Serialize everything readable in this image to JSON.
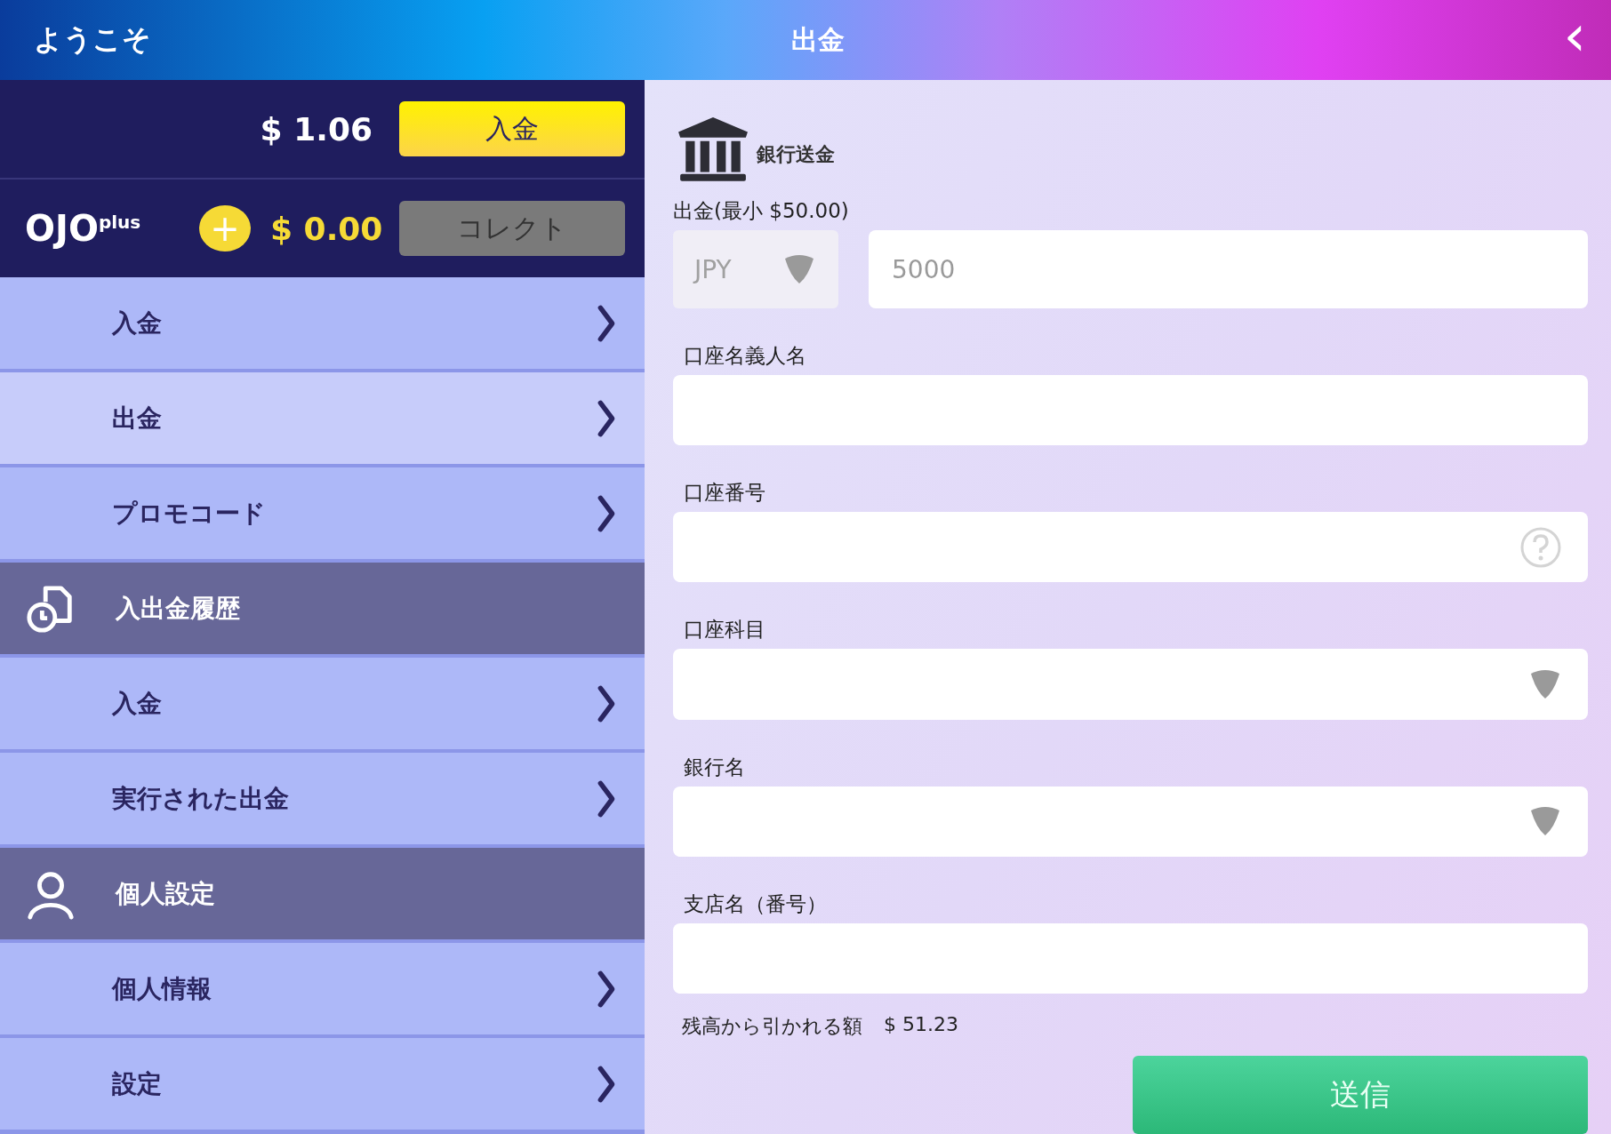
{
  "header": {
    "greeting": "ようこそ",
    "title": "出金",
    "back": "‹"
  },
  "balance": {
    "amount": "$ 1.06",
    "deposit_button": "入金"
  },
  "ojo": {
    "logo": "OJO",
    "logo_sup": "plus",
    "plus": "+",
    "amount": "$ 0.00",
    "collect_button": "コレクト"
  },
  "sidebar": {
    "items": [
      {
        "kind": "link",
        "label": "入金",
        "selected": false
      },
      {
        "kind": "link",
        "label": "出金",
        "selected": true
      },
      {
        "kind": "link",
        "label": "プロモコード",
        "selected": false
      },
      {
        "kind": "header",
        "label": "入出金履歴"
      },
      {
        "kind": "link",
        "label": "入金",
        "selected": false
      },
      {
        "kind": "link",
        "label": "実行された出金",
        "selected": false
      },
      {
        "kind": "header",
        "label": "個人設定"
      },
      {
        "kind": "link",
        "label": "個人情報",
        "selected": false
      },
      {
        "kind": "link",
        "label": "設定",
        "selected": false
      }
    ]
  },
  "form": {
    "method": "銀行送金",
    "amount_label": "出金(最小 $50.00)",
    "currency": "JPY",
    "amount_placeholder": "5000",
    "fields": [
      {
        "kind": "text",
        "label": "口座名義人名"
      },
      {
        "kind": "help",
        "label": "口座番号"
      },
      {
        "kind": "select",
        "label": "口座科目"
      },
      {
        "kind": "select",
        "label": "銀行名"
      },
      {
        "kind": "text",
        "label": "支店名（番号）"
      }
    ],
    "deducted_label": "残高から引かれる額",
    "deducted_amount": "$ 51.23",
    "submit": "送信"
  }
}
